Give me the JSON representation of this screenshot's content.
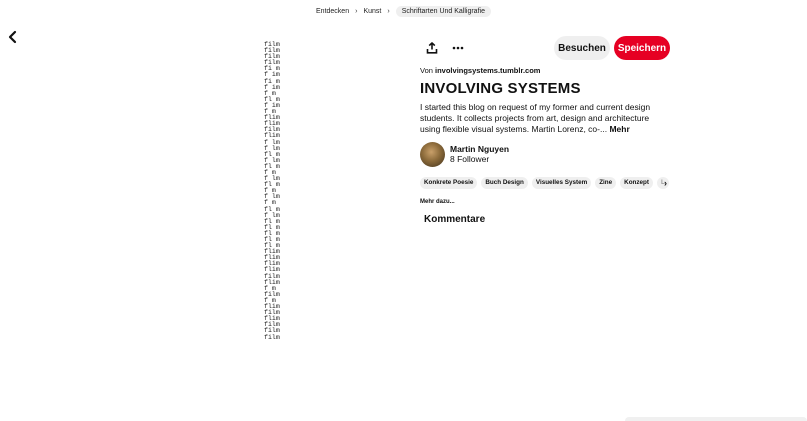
{
  "breadcrumb": {
    "items": [
      "Entdecken",
      "Kunst",
      "Schriftarten Und Kalligrafie"
    ]
  },
  "icons": {
    "back": "chevron-left-icon",
    "share": "share-upload-icon",
    "more": "more-horizontal-icon",
    "next": "chevron-right-icon"
  },
  "pin_image": {
    "lines": [
      "film",
      "film",
      "film",
      "film",
      "fi m",
      "f im",
      "fi m",
      "f im",
      "f m",
      "fl m",
      "f im",
      "f m",
      "flim",
      "flim",
      "film",
      "flim",
      "f lm",
      "f lm",
      "fl m",
      "f lm",
      "fl m",
      "f m",
      "f lm",
      "fl m",
      "f m",
      "f lm",
      "f m",
      "fl m",
      "f lm",
      "fl m",
      "fl m",
      "fl m",
      "fl m",
      "fl m",
      "flim",
      "flim",
      "flim",
      "flim",
      "film",
      "flim",
      "f m",
      "film",
      "f m",
      "flim",
      "film",
      "flim",
      "film",
      "film",
      "film"
    ]
  },
  "actions": {
    "visit_label": "Besuchen",
    "save_label": "Speichern",
    "save_color": "#e60023",
    "visit_color": "#efefef"
  },
  "pin": {
    "source_prefix": "Von ",
    "source_domain": "involvingsystems.tumblr.com",
    "title": "INVOLVING SYSTEMS",
    "description": "I started this blog on request of my former and current design students. It collects projects from art, design and architecture using flexible visual systems. Martin Lorenz, co-... ",
    "more_label": "Mehr"
  },
  "author": {
    "name": "Martin Nguyen",
    "followers": "8 Follower"
  },
  "tags": [
    "Konkrete Poesie",
    "Buch Design",
    "Visuelles System",
    "Zine",
    "Konzept",
    "L"
  ],
  "more_link": "Mehr dazu...",
  "comments_heading": "Kommentare"
}
